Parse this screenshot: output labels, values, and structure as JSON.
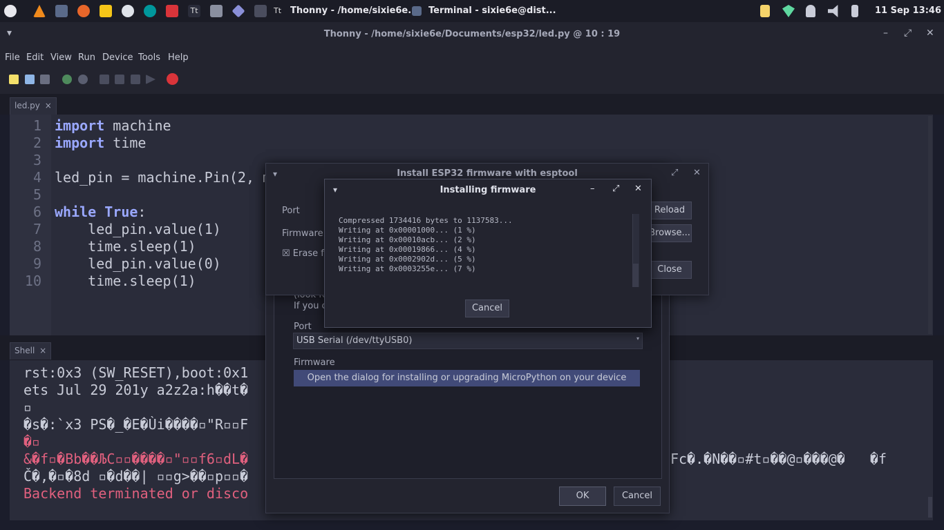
{
  "topbar": {
    "window1": "Thonny  -  /home/sixie6e...",
    "window2": "Terminal - sixie6e@dist...",
    "clock": "11 Sep 13:46"
  },
  "window": {
    "title": "Thonny  -  /home/sixie6e/Documents/esp32/led.py  @  10 : 19"
  },
  "menu": [
    "File",
    "Edit",
    "View",
    "Run",
    "Device",
    "Tools",
    "Help"
  ],
  "editor": {
    "tab_label": "led.py",
    "tab_close": "×",
    "line_numbers": [
      "1",
      "2",
      "3",
      "4",
      "5",
      "6",
      "7",
      "8",
      "9",
      "10"
    ],
    "lines": [
      {
        "kw": "import",
        "rest": " machine"
      },
      {
        "kw": "import",
        "rest": " time"
      },
      {
        "kw": "",
        "rest": ""
      },
      {
        "kw": "",
        "rest": "led_pin = machine.Pin(2, m"
      },
      {
        "kw": "",
        "rest": ""
      },
      {
        "kw": "while True",
        "rest": ":"
      },
      {
        "kw": "",
        "rest": "    led_pin.value(1)"
      },
      {
        "kw": "",
        "rest": "    time.sleep(1)"
      },
      {
        "kw": "",
        "rest": "    led_pin.value(0)"
      },
      {
        "kw": "",
        "rest": "    time.sleep(1)"
      }
    ]
  },
  "shell": {
    "tab_label": "Shell",
    "tab_close": "×",
    "lines": [
      "rst:0x3 (SW_RESET),boot:0x1",
      "ets Jul 29 201y a2z2a:h��t�",
      "▫",
      "�s�:`x3 PS�_�E�Ùi����▫\"R▫▫F",
      "�▫",
      "&�f▫�Bb��ЉC▫▫����▫\"▫▫f6▫dL�",
      "Č�,�▫�8d ▫�d��| ▫▫g>��▫p▫▫�",
      "Backend terminated or disco"
    ],
    "right_fragment": "Fc�.�N��▫#t▫��@▫���@�   �f"
  },
  "main_dialog": {
    "partial_text1": "(look fo",
    "partial_text2": "If you c",
    "port_label": "Port",
    "port_value": "USB Serial (/dev/ttyUSB0)",
    "firmware_label": "Firmware",
    "firmware_button": "Open the dialog for installing or upgrading MicroPython on your device",
    "ok_label": "OK",
    "cancel_label": "Cancel"
  },
  "esp_dialog": {
    "title": "Install ESP32 firmware with esptool",
    "port_label": "Port",
    "firmware_label": "Firmware",
    "erase_label": "Erase fla",
    "erase_checked": "☒",
    "reload_label": "Reload",
    "browse_label": "Browse...",
    "close_label": "Close"
  },
  "install_dialog": {
    "title": "Installing firmware",
    "log": [
      "Compressed 1734416 bytes to 1137583...",
      "Writing at 0x00001000... (1 %)",
      "Writing at 0x00010acb... (2 %)",
      "Writing at 0x00019866... (4 %)",
      "Writing at 0x0002902d... (5 %)",
      "Writing at 0x0003255e... (7 %)"
    ],
    "cancel_label": "Cancel"
  }
}
